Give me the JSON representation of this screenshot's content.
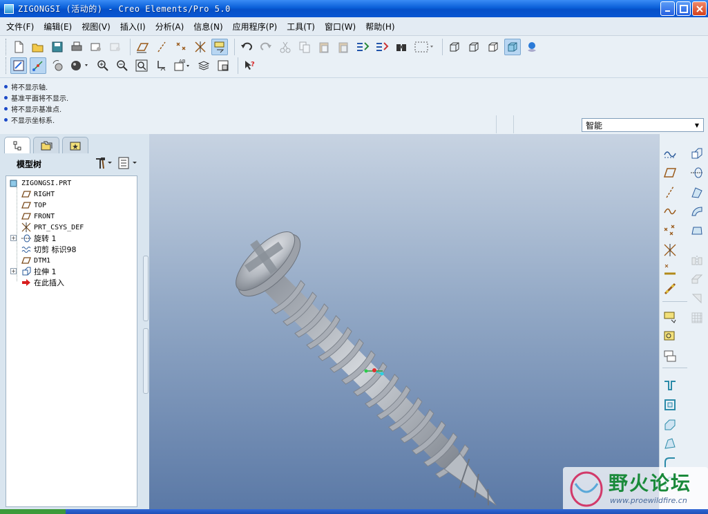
{
  "window": {
    "title": "ZIGONGSI (活动的) - Creo Elements/Pro 5.0",
    "buttons": [
      "minimize",
      "maximize",
      "close"
    ]
  },
  "menu": [
    "文件(F)",
    "编辑(E)",
    "视图(V)",
    "插入(I)",
    "分析(A)",
    "信息(N)",
    "应用程序(P)",
    "工具(T)",
    "窗口(W)",
    "帮助(H)"
  ],
  "toolbar": {
    "row1": [
      "new-icon",
      "open-icon",
      "save-icon",
      "print-icon",
      "send-mail-icon",
      "mail-attach-icon",
      "datum-plane-display-icon",
      "datum-axis-display-icon",
      "datum-point-display-icon",
      "csys-display-icon",
      "annotation-display-icon",
      "undo-icon",
      "redo-icon",
      "cut-icon",
      "copy-icon",
      "paste-icon",
      "paste-special-icon",
      "regenerate-icon",
      "regen-manager-icon",
      "find-icon",
      "select-box-icon",
      "wireframe-icon",
      "hidden-line-icon",
      "no-hidden-icon",
      "shading-icon",
      "appearance-icon"
    ],
    "row2": [
      "repaint-icon",
      "spin-center-icon",
      "orient-mode-icon",
      "appearance-sphere-icon",
      "zoom-in-icon",
      "zoom-out-icon",
      "refit-icon",
      "reorient-icon",
      "saved-views-icon",
      "layers-icon",
      "view-manager-icon",
      "context-help-icon"
    ]
  },
  "messages": [
    "将不显示轴.",
    "基准平面将不显示.",
    "将不显示基准点.",
    "不显示坐标系."
  ],
  "selection_filter": {
    "value": "智能"
  },
  "left_panel": {
    "tabs": [
      "model-tree-tab",
      "folder-browser-tab",
      "favorites-tab"
    ],
    "header": "模型树",
    "tree": [
      {
        "label": "ZIGONGSI.PRT",
        "icon": "part-icon",
        "expandable": false
      },
      {
        "label": "RIGHT",
        "icon": "datum-plane-icon",
        "expandable": false
      },
      {
        "label": "TOP",
        "icon": "datum-plane-icon",
        "expandable": false
      },
      {
        "label": "FRONT",
        "icon": "datum-plane-icon",
        "expandable": false
      },
      {
        "label": "PRT_CSYS_DEF",
        "icon": "csys-icon",
        "expandable": false
      },
      {
        "label": "旋转 1",
        "icon": "revolve-icon",
        "expandable": true
      },
      {
        "label": "切剪 标识98",
        "icon": "helical-cut-icon",
        "expandable": false
      },
      {
        "label": "DTM1",
        "icon": "datum-plane-icon",
        "expandable": false
      },
      {
        "label": "拉伸 1",
        "icon": "extrude-icon",
        "expandable": true
      },
      {
        "label": "在此插入",
        "icon": "insert-here-arrow-icon",
        "expandable": false
      }
    ]
  },
  "right_toolbar": [
    "sketched-datum-curve-icon",
    "datum-plane-tool-icon",
    "datum-axis-tool-icon",
    "datum-curve-tool-icon",
    "datum-point-tool-icon",
    "csys-tool-icon",
    "analysis-datum-icon",
    "relation-icon",
    "extrude-tool-icon",
    "revolve-tool-icon",
    "variable-sweep-icon",
    "blend-icon",
    "hole-icon",
    "shell-icon",
    "rib-icon",
    "draft-icon",
    "round-icon",
    "chamfer-icon",
    "mirror-icon",
    "merge-icon",
    "trim-icon",
    "pattern-icon"
  ],
  "watermark": {
    "title": "野火论坛",
    "url": "www.proewildfire.cn"
  },
  "colors": {
    "title_bar": "#0a5fd8",
    "panel_bg": "#e9f0f6",
    "viewport_top": "#c7d3e2",
    "viewport_bottom": "#5b79a6",
    "model": "#b9bec5"
  }
}
